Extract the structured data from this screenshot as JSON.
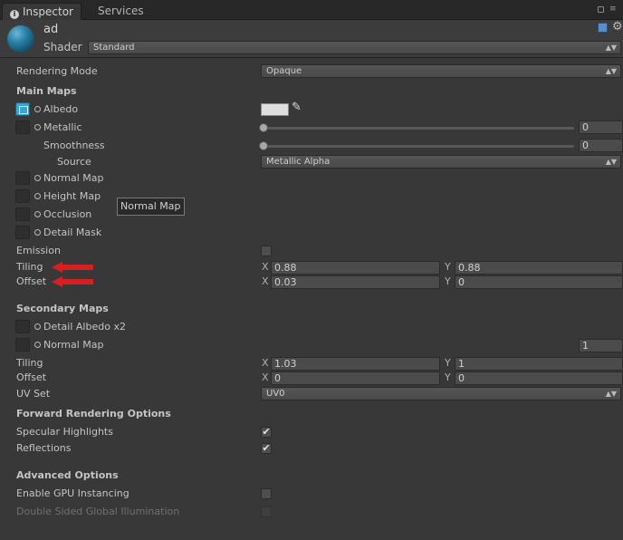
{
  "tabs": [
    {
      "label": "Inspector",
      "icon": "info-icon"
    },
    {
      "label": "Services"
    }
  ],
  "header": {
    "material_name": "ad",
    "shader_label": "Shader",
    "shader_value": "Standard"
  },
  "rendering_mode": {
    "label": "Rendering Mode",
    "value": "Opaque"
  },
  "main_maps": {
    "title": "Main Maps",
    "albedo": "Albedo",
    "metallic": {
      "label": "Metallic",
      "value": "0"
    },
    "smoothness": {
      "label": "Smoothness",
      "value": "0"
    },
    "source": {
      "label": "Source",
      "value": "Metallic Alpha"
    },
    "normal_map": "Normal Map",
    "height_map": "Height Map",
    "occlusion": "Occlusion",
    "detail_mask": "Detail Mask",
    "tooltip": "Normal Map",
    "emission": "Emission",
    "tiling": {
      "label": "Tiling",
      "x": "0.88",
      "y": "0.88"
    },
    "offset": {
      "label": "Offset",
      "x": "0.03",
      "y": "0"
    }
  },
  "secondary_maps": {
    "title": "Secondary Maps",
    "detail_albedo": "Detail Albedo x2",
    "normal_map": {
      "label": "Normal Map",
      "value": "1"
    },
    "tiling": {
      "label": "Tiling",
      "x": "1.03",
      "y": "1"
    },
    "offset": {
      "label": "Offset",
      "x": "0",
      "y": "0"
    },
    "uv_set": {
      "label": "UV Set",
      "value": "UV0"
    }
  },
  "forward": {
    "title": "Forward Rendering Options",
    "specular": "Specular Highlights",
    "reflections": "Reflections"
  },
  "advanced": {
    "title": "Advanced Options",
    "gpu_instancing": "Enable GPU Instancing",
    "double_sided_gi": "Double Sided Global Illumination"
  },
  "axis_labels": {
    "x": "X",
    "y": "Y"
  },
  "colors": {
    "background": "#383838",
    "accent_blue": "#3aa6d8",
    "annotation_red": "#d62020"
  }
}
